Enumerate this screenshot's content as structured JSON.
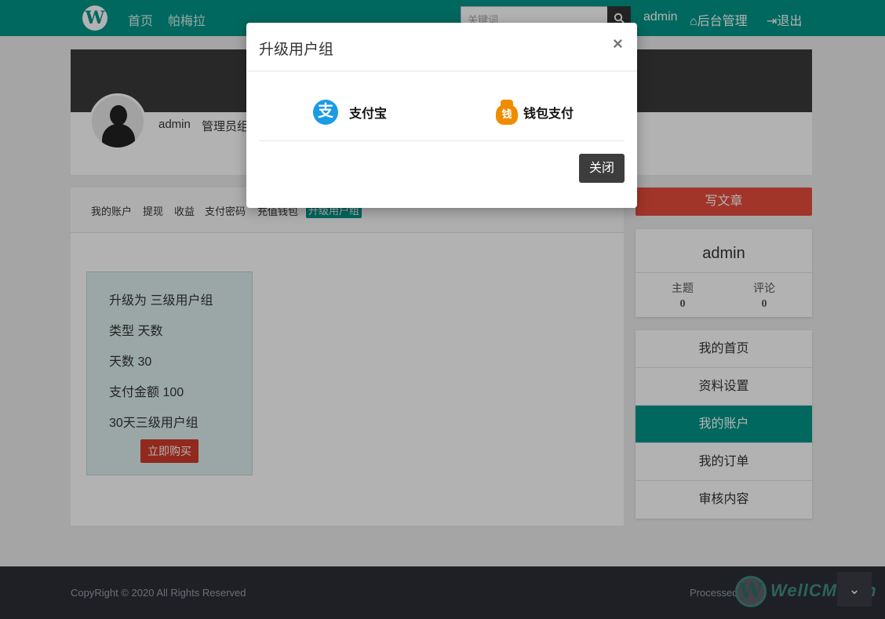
{
  "nav": {
    "logo_letter": "W",
    "links": [
      "首页",
      "帕梅拉"
    ],
    "search_placeholder": "关键词",
    "user": "admin",
    "admin": "后台管理",
    "logout": "退出"
  },
  "profile": {
    "name": "admin",
    "group": "管理员组"
  },
  "subnav": [
    "我的账户",
    "提现",
    "收益",
    "支付密码",
    "充值钱包",
    "升级用户组"
  ],
  "plan": {
    "upgrade_to": "升级为  三级用户组",
    "type": "类型  天数",
    "days": "天数  30",
    "amount": "支付金额  100",
    "name": "30天三级用户组",
    "buy_label": "立即购买"
  },
  "sidebar": {
    "write_label": "写文章",
    "username": "admin",
    "stats": [
      {
        "label": "主题",
        "value": "0"
      },
      {
        "label": "评论",
        "value": "0"
      }
    ],
    "menu": [
      "我的首页",
      "资料设置",
      "我的账户",
      "我的订单",
      "审核内容"
    ],
    "active_menu": "我的账户"
  },
  "footer": {
    "copyright": "CopyRight © 2020 All Rights Reserved",
    "processed": "Processed",
    "watermark_letter": "W",
    "watermark_text": "WellCMS.cn"
  },
  "modal": {
    "title": "升级用户组",
    "close_symbol": "×",
    "options": [
      {
        "icon": "alipay-icon",
        "glyph": "支",
        "label": "支付宝"
      },
      {
        "icon": "wallet-icon",
        "glyph": "钱",
        "label": "钱包支付"
      }
    ],
    "close_label": "关闭"
  },
  "colors": {
    "primary": "#009688",
    "danger": "#e74c3c",
    "dark": "#3a3a3a",
    "alipay": "#1a9be6",
    "wallet": "#f08c00"
  }
}
